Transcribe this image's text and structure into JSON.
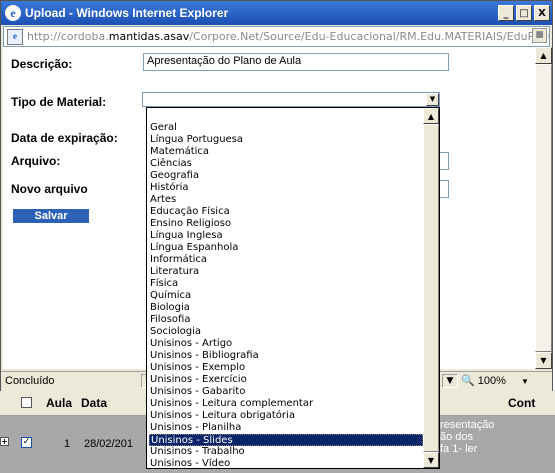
{
  "window": {
    "title": "Upload - Windows Internet Explorer",
    "ie_icon_glyph": "e",
    "minimize": "_",
    "maximize": "□",
    "close": "X"
  },
  "address": {
    "prefix": "http://cordoba.",
    "domain": "mantidas.asav",
    "suffix": "/Corpore.Net/Source/Edu-Educacional/RM.Edu.MATERIAIS/EduPopupU"
  },
  "form": {
    "descricao_label": "Descrição:",
    "descricao_value": "Apresentação do Plano de Aula",
    "tipo_label": "Tipo de Material:",
    "data_label": "Data de expiração:",
    "arquivo_label": "Arquivo:",
    "novo_arquivo_label": "Novo arquivo",
    "salvar_label": "Salvar"
  },
  "dropdown": {
    "options": [
      "Geral",
      "Língua Portuguesa",
      "Matemática",
      "Ciências",
      "Geografia",
      "História",
      "Artes",
      "Educação Física",
      "Ensino Religioso",
      "Língua Inglesa",
      "Língua Espanhola",
      "Informática",
      "Literatura",
      "Física",
      "Química",
      "Biologia",
      "Filosofia",
      "Sociologia",
      "Unisinos - Artigo",
      "Unisinos - Bibliografia",
      "Unisinos - Exemplo",
      "Unisinos - Exercício",
      "Unisinos - Gabarito",
      "Unisinos - Leitura complementar",
      "Unisinos - Leitura obrigatória",
      "Unisinos - Planilha",
      "Unisinos - Slides",
      "Unisinos - Trabalho",
      "Unisinos - Vídeo"
    ],
    "selected": "Unisinos - Slides"
  },
  "statusbar": {
    "status": "Concluído",
    "zoom": "100%"
  },
  "grid": {
    "headers": {
      "aula": "Aula",
      "data": "Data",
      "cont": "Cont"
    },
    "row": {
      "aula": "1",
      "data": "28/02/201",
      "desc_line1": "resentação",
      "desc_line2": "ão dos",
      "desc_line3": "fa 1- ler"
    }
  }
}
